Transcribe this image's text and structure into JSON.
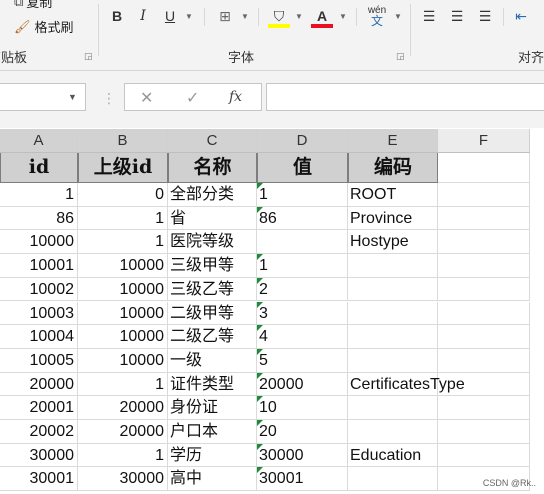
{
  "ribbon": {
    "copy_label": "复制",
    "format_painter_label": "格式刷",
    "clipboard_label": "剪贴板",
    "font_label": "字体",
    "alignment_label": "对齐",
    "bold": "B",
    "italic": "I",
    "underline": "U",
    "font_color_glyph": "A",
    "phonetic_top": "wén",
    "phonetic_bottom": "文",
    "highlight_color": "#ffff00",
    "font_color": "#e81123"
  },
  "formula_bar": {
    "cancel_glyph": "✕",
    "enter_glyph": "✓",
    "fx_glyph": "fx",
    "formula_value": ""
  },
  "columns": [
    "A",
    "B",
    "C",
    "D",
    "E",
    "F"
  ],
  "table": {
    "headers": [
      "id",
      "上级id",
      "名称",
      "值",
      "编码"
    ],
    "rows": [
      {
        "id": "1",
        "parent": "0",
        "name": "全部分类",
        "value": "1",
        "code": "ROOT"
      },
      {
        "id": "86",
        "parent": "1",
        "name": "省",
        "value": "86",
        "code": "Province"
      },
      {
        "id": "10000",
        "parent": "1",
        "name": "医院等级",
        "value": "",
        "code": "Hostype"
      },
      {
        "id": "10001",
        "parent": "10000",
        "name": "三级甲等",
        "value": "1",
        "code": ""
      },
      {
        "id": "10002",
        "parent": "10000",
        "name": "三级乙等",
        "value": "2",
        "code": ""
      },
      {
        "id": "10003",
        "parent": "10000",
        "name": "二级甲等",
        "value": "3",
        "code": ""
      },
      {
        "id": "10004",
        "parent": "10000",
        "name": "二级乙等",
        "value": "4",
        "code": ""
      },
      {
        "id": "10005",
        "parent": "10000",
        "name": "一级",
        "value": "5",
        "code": ""
      },
      {
        "id": "20000",
        "parent": "1",
        "name": "证件类型",
        "value": "20000",
        "code": "CertificatesType"
      },
      {
        "id": "20001",
        "parent": "20000",
        "name": "身份证",
        "value": "10",
        "code": ""
      },
      {
        "id": "20002",
        "parent": "20000",
        "name": "户口本",
        "value": "20",
        "code": ""
      },
      {
        "id": "30000",
        "parent": "1",
        "name": "学历",
        "value": "30000",
        "code": "Education"
      },
      {
        "id": "30001",
        "parent": "30000",
        "name": "高中",
        "value": "30001",
        "code": ""
      }
    ]
  },
  "watermark": "CSDN @Rk.."
}
